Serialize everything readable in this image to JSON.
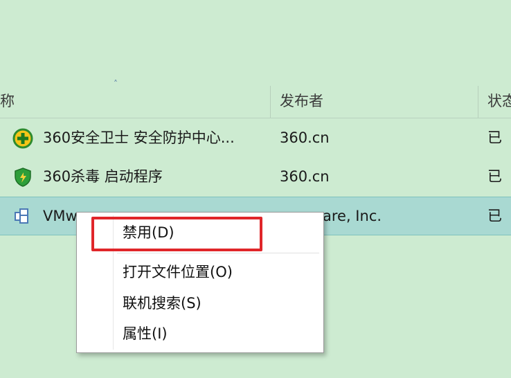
{
  "header": {
    "sort_glyph": "˄",
    "columns": [
      "称",
      "发布者",
      "状态"
    ]
  },
  "rows": [
    {
      "name": "360安全卫士 安全防护中心...",
      "publisher": "360.cn",
      "status": "已",
      "icon": "360-safeguard-icon"
    },
    {
      "name": "360杀毒 启动程序",
      "publisher": "360.cn",
      "status": "已",
      "icon": "360-antivirus-shield-icon"
    },
    {
      "name": "VMw",
      "publisher": "are, Inc.",
      "status": "已",
      "icon": "vmware-tray-icon",
      "selected": true
    }
  ],
  "context_menu": {
    "items": [
      "禁用(D)",
      "打开文件位置(O)",
      "联机搜索(S)",
      "属性(I)"
    ]
  },
  "colors": {
    "background": "#cdebd1",
    "selection": "#a9d9d2",
    "highlight_border": "#e0262a"
  }
}
